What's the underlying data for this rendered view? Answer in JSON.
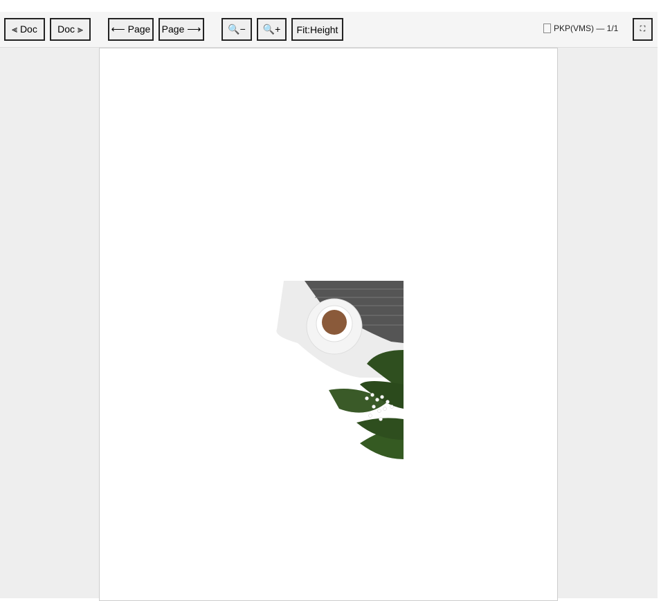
{
  "toolbar": {
    "prev_doc": "⫷ Doc",
    "next_doc": "Doc ⫸",
    "prev_page": "⟵ Page",
    "next_page": "Page ⟶",
    "zoom_out": "🔍−",
    "zoom_in": "🔍+",
    "fit": "Fit:Height",
    "fullscreen": "⛶"
  },
  "document": {
    "title": "PKP(VMS) — 1/1"
  }
}
